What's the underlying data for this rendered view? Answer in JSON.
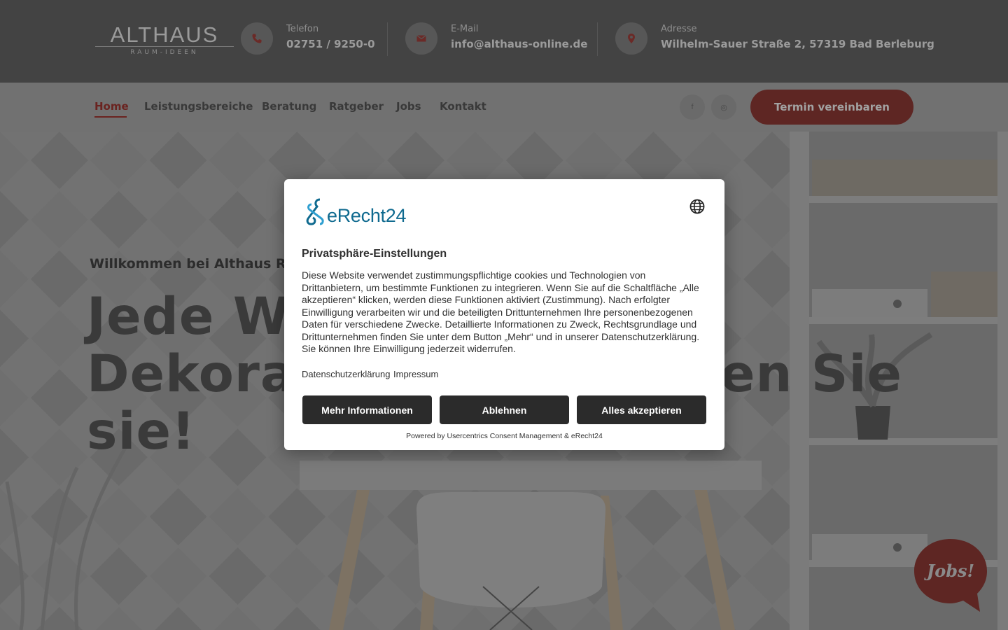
{
  "header": {
    "logo": {
      "main": "ALTHAUS",
      "sub": "RAUM-IDEEN"
    },
    "contacts": [
      {
        "icon": "phone-icon",
        "label": "Telefon",
        "value": "02751 / 9250-0"
      },
      {
        "icon": "mail-icon",
        "label": "E-Mail",
        "value": "info@althaus-online.de"
      },
      {
        "icon": "location-pin-icon",
        "label": "Adresse",
        "value": "Wilhelm-Sauer Straße 2, 57319 Bad Berleburg"
      }
    ]
  },
  "nav": {
    "items": [
      {
        "label": "Home",
        "active": true
      },
      {
        "label": "Leistungsbereiche"
      },
      {
        "label": "Beratung"
      },
      {
        "label": "Ratgeber"
      },
      {
        "label": "Jobs"
      },
      {
        "label": "Kontakt"
      }
    ],
    "social": [
      {
        "icon": "facebook-icon",
        "glyph": "f"
      },
      {
        "icon": "instagram-icon",
        "glyph": "◎"
      }
    ],
    "cta_label": "Termin vereinbaren"
  },
  "hero": {
    "subtitle": "Willkommen bei Althaus Rau",
    "title_line1": "Jede W",
    "title_line2_left": "Dekora",
    "title_line2_right": "en Sie",
    "title_line3": "sie!"
  },
  "jobs_badge": {
    "label": "Jobs!"
  },
  "consent": {
    "brand": "eRecht24",
    "title": "Privatsphäre-Einstellungen",
    "text": "Diese Website verwendet zustimmungspflichtige cookies und Technologien von Drittanbietern, um bestimmte Funktionen zu integrieren. Wenn Sie auf die Schaltfläche „Alle akzeptieren“ klicken, werden diese Funktionen aktiviert (Zustimmung). Nach erfolgter Einwilligung verarbeiten wir und die beteiligten Drittunternehmen Ihre personenbezogenen Daten für verschiedene Zwecke. Detaillierte Informationen zu Zweck, Rechtsgrundlage und Drittunternehmen finden Sie unter dem Button „Mehr“ und in unserer Datenschutzerklärung. Sie können Ihre Einwilligung jederzeit widerrufen.",
    "links": [
      "Datenschutzerklärung",
      "Impressum"
    ],
    "buttons": {
      "more": "Mehr Informationen",
      "deny": "Ablehnen",
      "accept": "Alles akzeptieren"
    },
    "powered_by": "Powered by Usercentrics Consent Management & eRecht24"
  },
  "colors": {
    "brand_red": "#a83a33",
    "topbar_bg": "#434343",
    "erecht_blue": "#0f6a8f",
    "button_dark": "#2b2b2b"
  }
}
